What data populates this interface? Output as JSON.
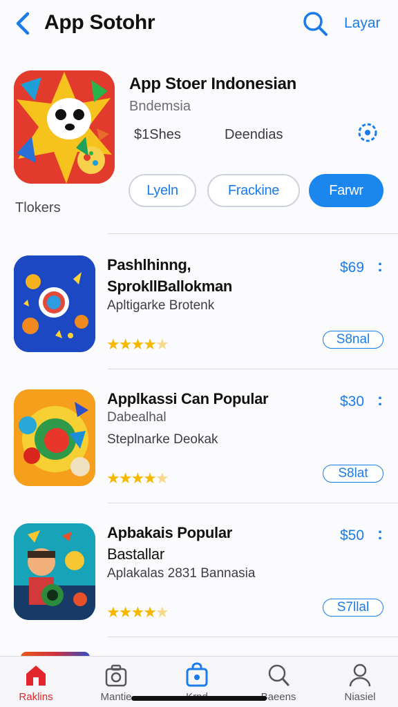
{
  "header": {
    "title": "App Sotohr",
    "action_link": "Layar"
  },
  "featured": {
    "title": "App Stoer Indonesian",
    "subtitle": "Bndemsia",
    "price": "$1Shes",
    "downloads": "Deendias",
    "buttons": [
      "Lyeln",
      "Frackine",
      "Farwr"
    ],
    "section_label": "Tlokers"
  },
  "apps": [
    {
      "title_line1": "Pashlhinng,",
      "title_line2": "SprokllBallokman",
      "subtitle": "",
      "category": "Apltigarke Brotenk",
      "rating": 4.5,
      "price": "$69",
      "menu": ":",
      "action": "S8nal"
    },
    {
      "title_line1": "Applkassi Can Popular",
      "title_line2": "",
      "subtitle": "Dabealhal",
      "category": "Steplnarke Deokak",
      "rating": 4.5,
      "price": "$30",
      "menu": ":",
      "action": "S8lat"
    },
    {
      "title_line1": "Apbakais Popular",
      "title_line2": "Bastallar",
      "subtitle": "",
      "category": "Aplakalas 2831 Bannasia",
      "rating": 4.5,
      "price": "$50",
      "menu": ":",
      "action": "S7llal"
    }
  ],
  "tabs": [
    {
      "label": "Raklins",
      "icon": "home-icon",
      "active": true
    },
    {
      "label": "Mantie",
      "icon": "camera-icon",
      "active": false
    },
    {
      "label": "Krnd",
      "icon": "bag-icon",
      "active": false
    },
    {
      "label": "Baeens",
      "icon": "search-icon",
      "active": false
    },
    {
      "label": "Niasiel",
      "icon": "person-icon",
      "active": false
    }
  ],
  "colors": {
    "accent": "#1a7bea",
    "active_tab": "#e3262c",
    "star": "#f5b800"
  }
}
